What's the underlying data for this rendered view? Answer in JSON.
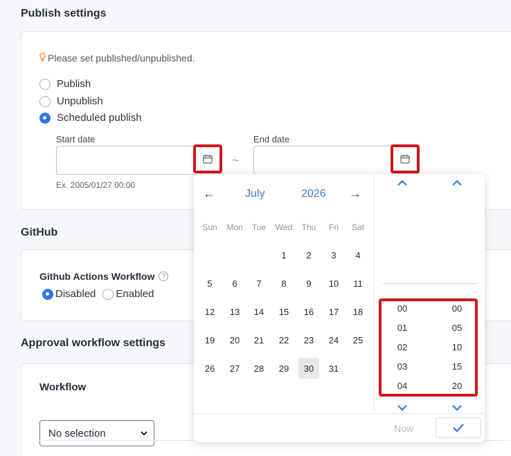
{
  "publish": {
    "title": "Publish settings",
    "hint": "Please set published/unpublished.",
    "options": [
      {
        "label": "Publish",
        "selected": false
      },
      {
        "label": "Unpublish",
        "selected": false
      },
      {
        "label": "Scheduled publish",
        "selected": true
      }
    ],
    "start_label": "Start date",
    "end_label": "End date",
    "separator": "~",
    "example": "Ex. 2005/01/27 00:00"
  },
  "github": {
    "title": "GitHub",
    "workflow_label": "Github Actions Workflow",
    "help": "?",
    "disabled_label": "Disabled",
    "enabled_label": "Enabled",
    "selected": "Disabled"
  },
  "approval": {
    "title": "Approval workflow settings",
    "workflow_label": "Workflow",
    "select_value": "No selection"
  },
  "picker": {
    "prev": "←",
    "next": "→",
    "month": "July",
    "year": "2026",
    "weekdays": [
      "Sun",
      "Mon",
      "Tue",
      "Wed",
      "Thu",
      "Fri",
      "Sat"
    ],
    "weeks": [
      [
        "",
        "",
        "",
        "1",
        "2",
        "3",
        "4"
      ],
      [
        "5",
        "6",
        "7",
        "8",
        "9",
        "10",
        "11"
      ],
      [
        "12",
        "13",
        "14",
        "15",
        "16",
        "17",
        "18"
      ],
      [
        "19",
        "20",
        "21",
        "22",
        "23",
        "24",
        "25"
      ],
      [
        "26",
        "27",
        "28",
        "29",
        "30",
        "31",
        ""
      ]
    ],
    "selected_day": "30",
    "hours": [
      "00",
      "01",
      "02",
      "03",
      "04"
    ],
    "minutes": [
      "00",
      "05",
      "10",
      "15",
      "20"
    ],
    "now_label": "Now"
  },
  "colors": {
    "accent": "#2f77e4",
    "highlight": "#d3141a"
  }
}
